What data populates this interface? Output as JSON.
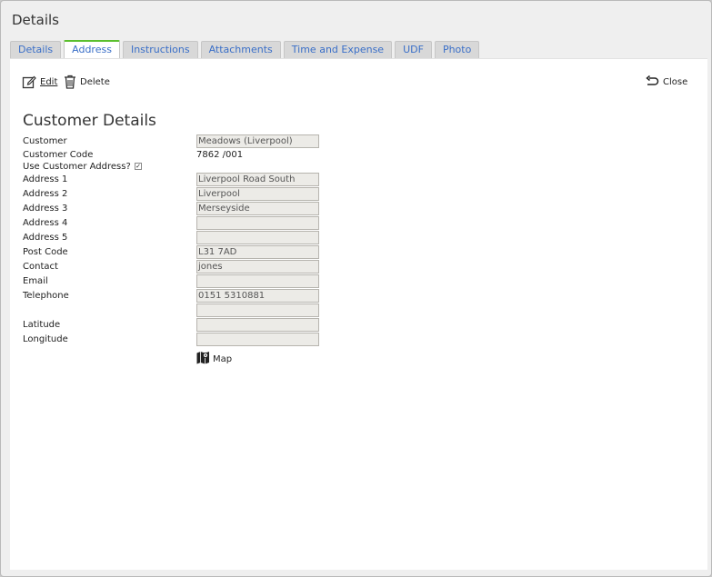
{
  "dialog": {
    "title": "Details"
  },
  "tabs": [
    {
      "label": "Details",
      "active": false
    },
    {
      "label": "Address",
      "active": true
    },
    {
      "label": "Instructions",
      "active": false
    },
    {
      "label": "Attachments",
      "active": false
    },
    {
      "label": "Time and Expense",
      "active": false
    },
    {
      "label": "UDF",
      "active": false
    },
    {
      "label": "Photo",
      "active": false
    }
  ],
  "toolbar": {
    "edit_label": "Edit",
    "delete_label": "Delete",
    "close_label": "Close"
  },
  "section": {
    "title": "Customer Details"
  },
  "form": {
    "customer_label": "Customer",
    "customer_value": "Meadows (Liverpool)",
    "customer_code_label": "Customer Code",
    "customer_code_value": "7862 /001",
    "use_customer_address_label": "Use Customer Address?",
    "use_customer_address_checked": true,
    "address1_label": "Address 1",
    "address1_value": "Liverpool Road South",
    "address2_label": "Address 2",
    "address2_value": "Liverpool",
    "address3_label": "Address 3",
    "address3_value": "Merseyside",
    "address4_label": "Address 4",
    "address4_value": "",
    "address5_label": "Address 5",
    "address5_value": "",
    "postcode_label": "Post Code",
    "postcode_value": "L31 7AD",
    "contact_label": "Contact",
    "contact_value": "jones",
    "email_label": "Email",
    "email_value": "",
    "telephone_label": "Telephone",
    "telephone_value": "0151 5310881",
    "telephone2_value": "",
    "latitude_label": "Latitude",
    "latitude_value": "",
    "longitude_label": "Longitude",
    "longitude_value": "",
    "map_label": "Map"
  }
}
